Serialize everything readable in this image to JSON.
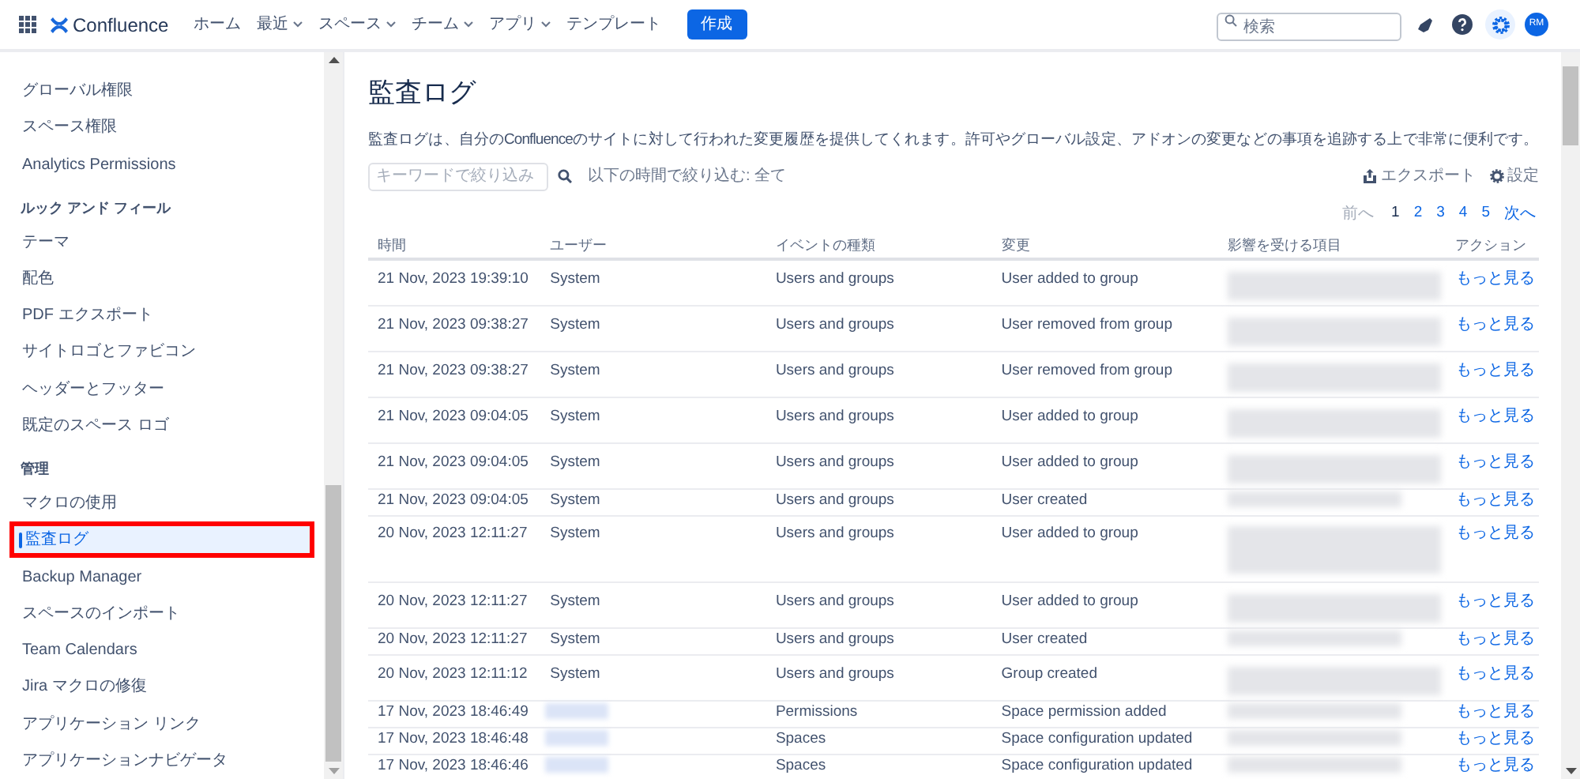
{
  "topbar": {
    "product": "Confluence",
    "nav": [
      {
        "label": "ホーム",
        "has_menu": false
      },
      {
        "label": "最近",
        "has_menu": true
      },
      {
        "label": "スペース",
        "has_menu": true
      },
      {
        "label": "チーム",
        "has_menu": true
      },
      {
        "label": "アプリ",
        "has_menu": true
      },
      {
        "label": "テンプレート",
        "has_menu": false
      }
    ],
    "create": "作成",
    "search": {
      "placeholder": "検索"
    },
    "avatar": "RM"
  },
  "sidebar": {
    "items": [
      {
        "kind": "link",
        "label": "グローバル権限",
        "selected": false
      },
      {
        "kind": "link",
        "label": "スペース権限",
        "selected": false
      },
      {
        "kind": "link",
        "label": "Analytics Permissions",
        "selected": false
      },
      {
        "kind": "heading",
        "label": "ルック アンド フィール"
      },
      {
        "kind": "link",
        "label": "テーマ",
        "selected": false
      },
      {
        "kind": "link",
        "label": "配色",
        "selected": false
      },
      {
        "kind": "link",
        "label": "PDF エクスポート",
        "selected": false
      },
      {
        "kind": "link",
        "label": "サイトロゴとファビコン",
        "selected": false
      },
      {
        "kind": "link",
        "label": "ヘッダーとフッター",
        "selected": false
      },
      {
        "kind": "link",
        "label": "既定のスペース ロゴ",
        "selected": false
      },
      {
        "kind": "heading",
        "label": "管理"
      },
      {
        "kind": "link",
        "label": "マクロの使用",
        "selected": false
      },
      {
        "kind": "link",
        "label": "監査ログ",
        "selected": true
      },
      {
        "kind": "link",
        "label": "Backup Manager",
        "selected": false
      },
      {
        "kind": "link",
        "label": "スペースのインポート",
        "selected": false
      },
      {
        "kind": "link",
        "label": "Team Calendars",
        "selected": false
      },
      {
        "kind": "link",
        "label": "Jira マクロの修復",
        "selected": false
      },
      {
        "kind": "link",
        "label": "アプリケーション リンク",
        "selected": false
      },
      {
        "kind": "link",
        "label": "アプリケーションナビゲータ",
        "selected": false
      }
    ]
  },
  "main": {
    "title": "監査ログ",
    "description": "監査ログは、自分のConfluenceのサイトに対して行われた変更履歴を提供してくれます。許可やグローバル設定、アドオンの変更などの事項を追跡する上で非常に便利です。",
    "filter": {
      "placeholder": "キーワードで絞り込み"
    },
    "time_filter": "以下の時間で絞り込む: 全て",
    "export": "エクスポート",
    "settings": "設定",
    "pagination": {
      "prev": "前へ",
      "pages": [
        {
          "label": "1",
          "selected": true
        },
        {
          "label": "2",
          "selected": false
        },
        {
          "label": "3",
          "selected": false
        },
        {
          "label": "4",
          "selected": false
        },
        {
          "label": "5",
          "selected": false
        }
      ],
      "next": "次へ"
    },
    "table": {
      "columns": [
        "時間",
        "ユーザー",
        "イベントの種類",
        "変更",
        "影響を受ける項目",
        "アクション"
      ],
      "rows": [
        {
          "kind": "normal",
          "time": "21 Nov, 2023 19:39:10",
          "user": "System",
          "event": "Users and groups",
          "change": "User added to group",
          "action": "もっと見る"
        },
        {
          "kind": "normal",
          "time": "21 Nov, 2023 09:38:27",
          "user": "System",
          "event": "Users and groups",
          "change": "User removed from group",
          "action": "もっと見る"
        },
        {
          "kind": "normal",
          "time": "21 Nov, 2023 09:38:27",
          "user": "System",
          "event": "Users and groups",
          "change": "User removed from group",
          "action": "もっと見る"
        },
        {
          "kind": "normal",
          "time": "21 Nov, 2023 09:04:05",
          "user": "System",
          "event": "Users and groups",
          "change": "User added to group",
          "action": "もっと見る"
        },
        {
          "kind": "normal",
          "time": "21 Nov, 2023 09:04:05",
          "user": "System",
          "event": "Users and groups",
          "change": "User added to group",
          "action": "もっと見る"
        },
        {
          "kind": "compact",
          "time": "21 Nov, 2023 09:04:05",
          "user": "System",
          "event": "Users and groups",
          "change": "User created",
          "action": "もっと見る"
        },
        {
          "kind": "tall",
          "time": "20 Nov, 2023 12:11:27",
          "user": "System",
          "event": "Users and groups",
          "change": "User added to group",
          "action": "もっと見る"
        },
        {
          "kind": "normal",
          "time": "20 Nov, 2023 12:11:27",
          "user": "System",
          "event": "Users and groups",
          "change": "User added to group",
          "action": "もっと見る"
        },
        {
          "kind": "compact",
          "time": "20 Nov, 2023 12:11:27",
          "user": "System",
          "event": "Users and groups",
          "change": "User created",
          "action": "もっと見る"
        },
        {
          "kind": "normal",
          "time": "20 Nov, 2023 12:11:12",
          "user": "System",
          "event": "Users and groups",
          "change": "Group created",
          "action": "もっと見る"
        },
        {
          "kind": "compact",
          "time": "17 Nov, 2023 18:46:49",
          "user_hidden": true,
          "event": "Permissions",
          "change": "Space permission added",
          "action": "もっと見る"
        },
        {
          "kind": "compact",
          "time": "17 Nov, 2023 18:46:48",
          "user_hidden": true,
          "event": "Spaces",
          "change": "Space configuration updated",
          "action": "もっと見る"
        },
        {
          "kind": "compact",
          "time": "17 Nov, 2023 18:46:46",
          "user_hidden": true,
          "event": "Spaces",
          "change": "Space configuration updated",
          "action": "もっと見る"
        }
      ]
    }
  }
}
